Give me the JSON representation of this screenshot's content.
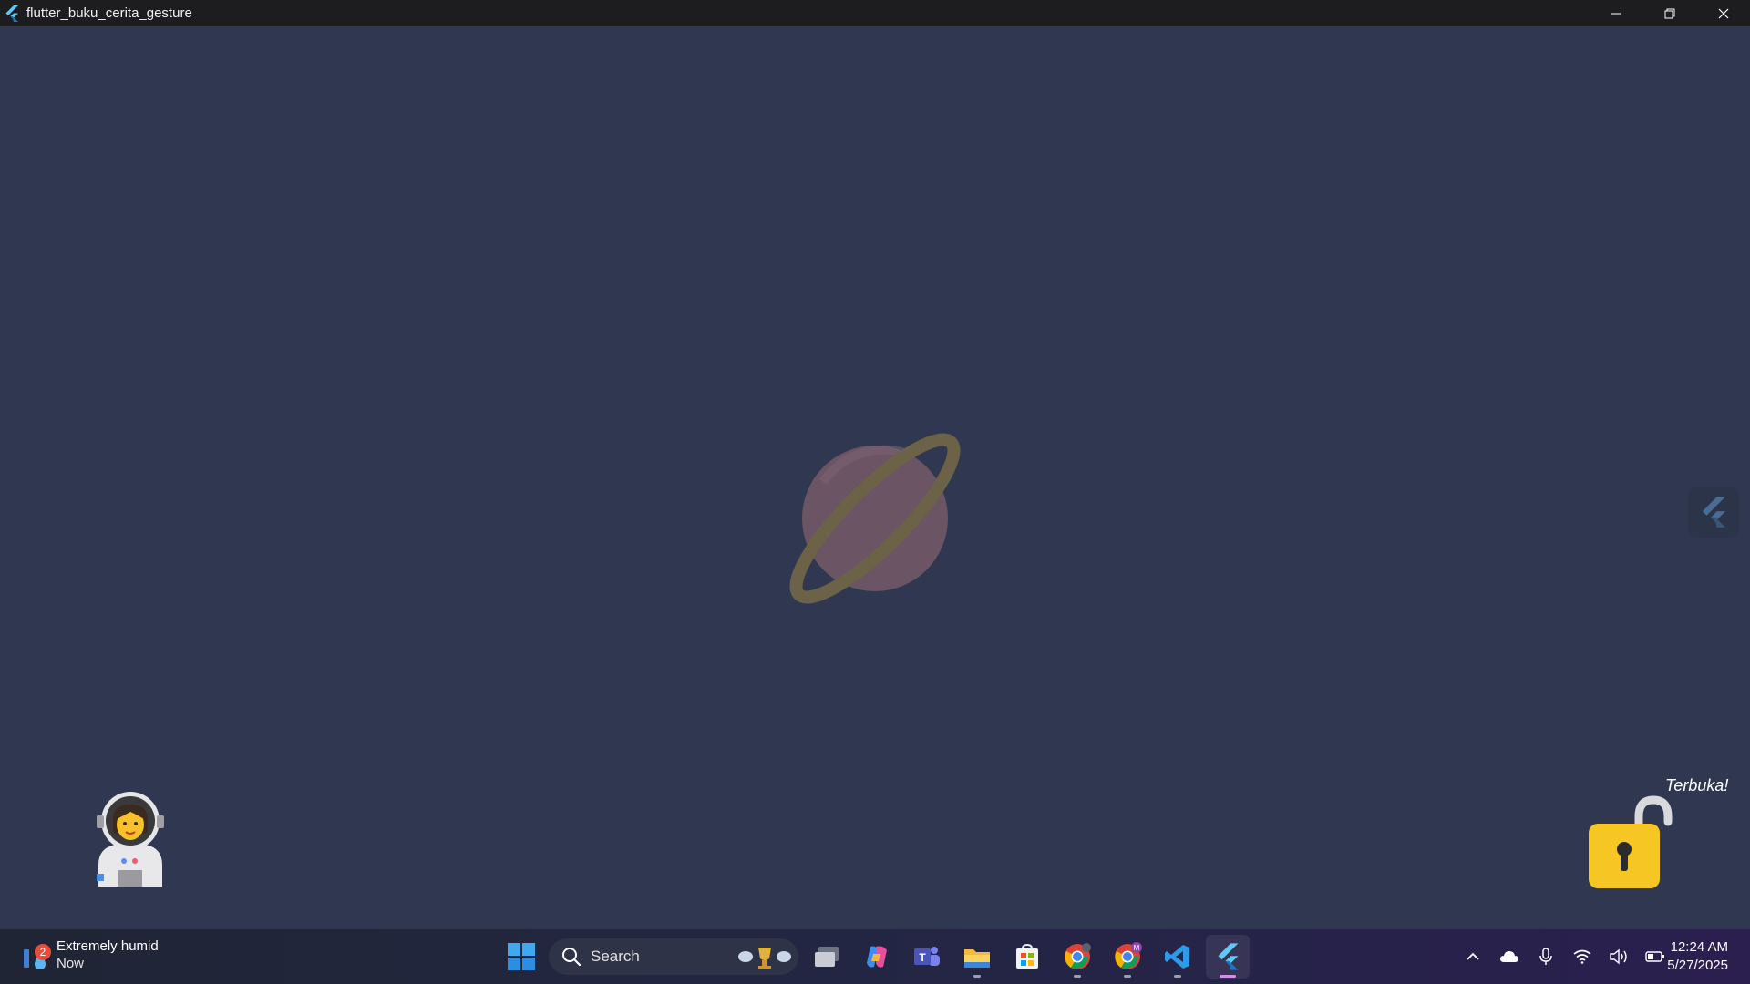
{
  "window": {
    "title": "flutter_buku_cerita_gesture",
    "controls": {
      "minimize": "minimize-icon",
      "restore": "restore-icon",
      "close": "close-icon"
    }
  },
  "app": {
    "background_color": "#2f3850",
    "planet_icon": "ringed-planet-icon",
    "side_tab_icon": "flutter-logo-icon",
    "character_icon": "astronaut-icon",
    "lock_icon": "unlocked-padlock-icon",
    "lock_status": "Terbuka!"
  },
  "taskbar": {
    "weather": {
      "badge": "2",
      "title": "Extremely humid",
      "subtitle": "Now"
    },
    "search_placeholder": "Search",
    "apps": [
      {
        "name": "task-view",
        "icon": "task-view-icon"
      },
      {
        "name": "copilot",
        "icon": "copilot-icon"
      },
      {
        "name": "teams",
        "icon": "teams-icon"
      },
      {
        "name": "file-explorer",
        "icon": "folder-icon"
      },
      {
        "name": "store",
        "icon": "store-icon"
      },
      {
        "name": "chrome",
        "icon": "chrome-icon"
      },
      {
        "name": "chrome-profile",
        "icon": "chrome-icon",
        "badge": "M"
      },
      {
        "name": "vscode",
        "icon": "vscode-icon"
      },
      {
        "name": "flutter-app",
        "icon": "flutter-icon"
      }
    ],
    "tray": [
      "chevron-up-icon",
      "onedrive-icon",
      "microphone-icon",
      "wifi-icon",
      "volume-icon",
      "battery-icon"
    ],
    "time": "12:24 AM",
    "date": "5/27/2025"
  }
}
